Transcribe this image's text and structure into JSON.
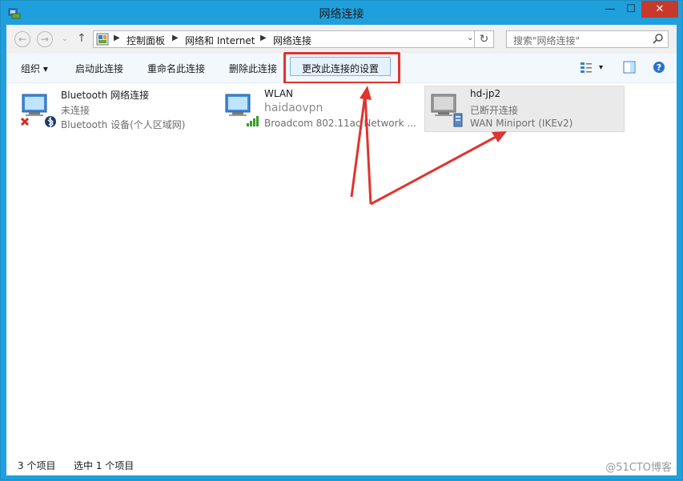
{
  "window": {
    "title": "网络连接",
    "minimize": "—",
    "maximize": "☐",
    "close": "✕"
  },
  "nav": {
    "back": "←",
    "forward": "→",
    "up": "↑",
    "refresh": "↻"
  },
  "address": {
    "breadcrumbs": [
      "控制面板",
      "网络和 Internet",
      "网络连接"
    ],
    "separator": "▶",
    "dropdown": "⌄"
  },
  "search": {
    "placeholder": "搜索\"网络连接\""
  },
  "toolbar": {
    "organize": "组织 ▾",
    "start": "启动此连接",
    "rename": "重命名此连接",
    "delete": "删除此连接",
    "change_settings": "更改此连接的设置",
    "view_dropdown": "▾"
  },
  "connections": [
    {
      "name": "Bluetooth 网络连接",
      "status": "未连接",
      "device": "Bluetooth 设备(个人区域网)"
    },
    {
      "name": "WLAN",
      "status": "haidaovpn",
      "device": "Broadcom 802.11ac Network ..."
    },
    {
      "name": "hd-jp2",
      "status": "已断开连接",
      "device": "WAN Miniport (IKEv2)"
    }
  ],
  "status": {
    "count": "3 个项目",
    "selected": "选中 1 个项目",
    "watermark": "@51CTO博客"
  },
  "colors": {
    "highlight_red": "#e0342f",
    "arrow_red": "#e0342f",
    "title_blue": "#1fa0dc"
  }
}
